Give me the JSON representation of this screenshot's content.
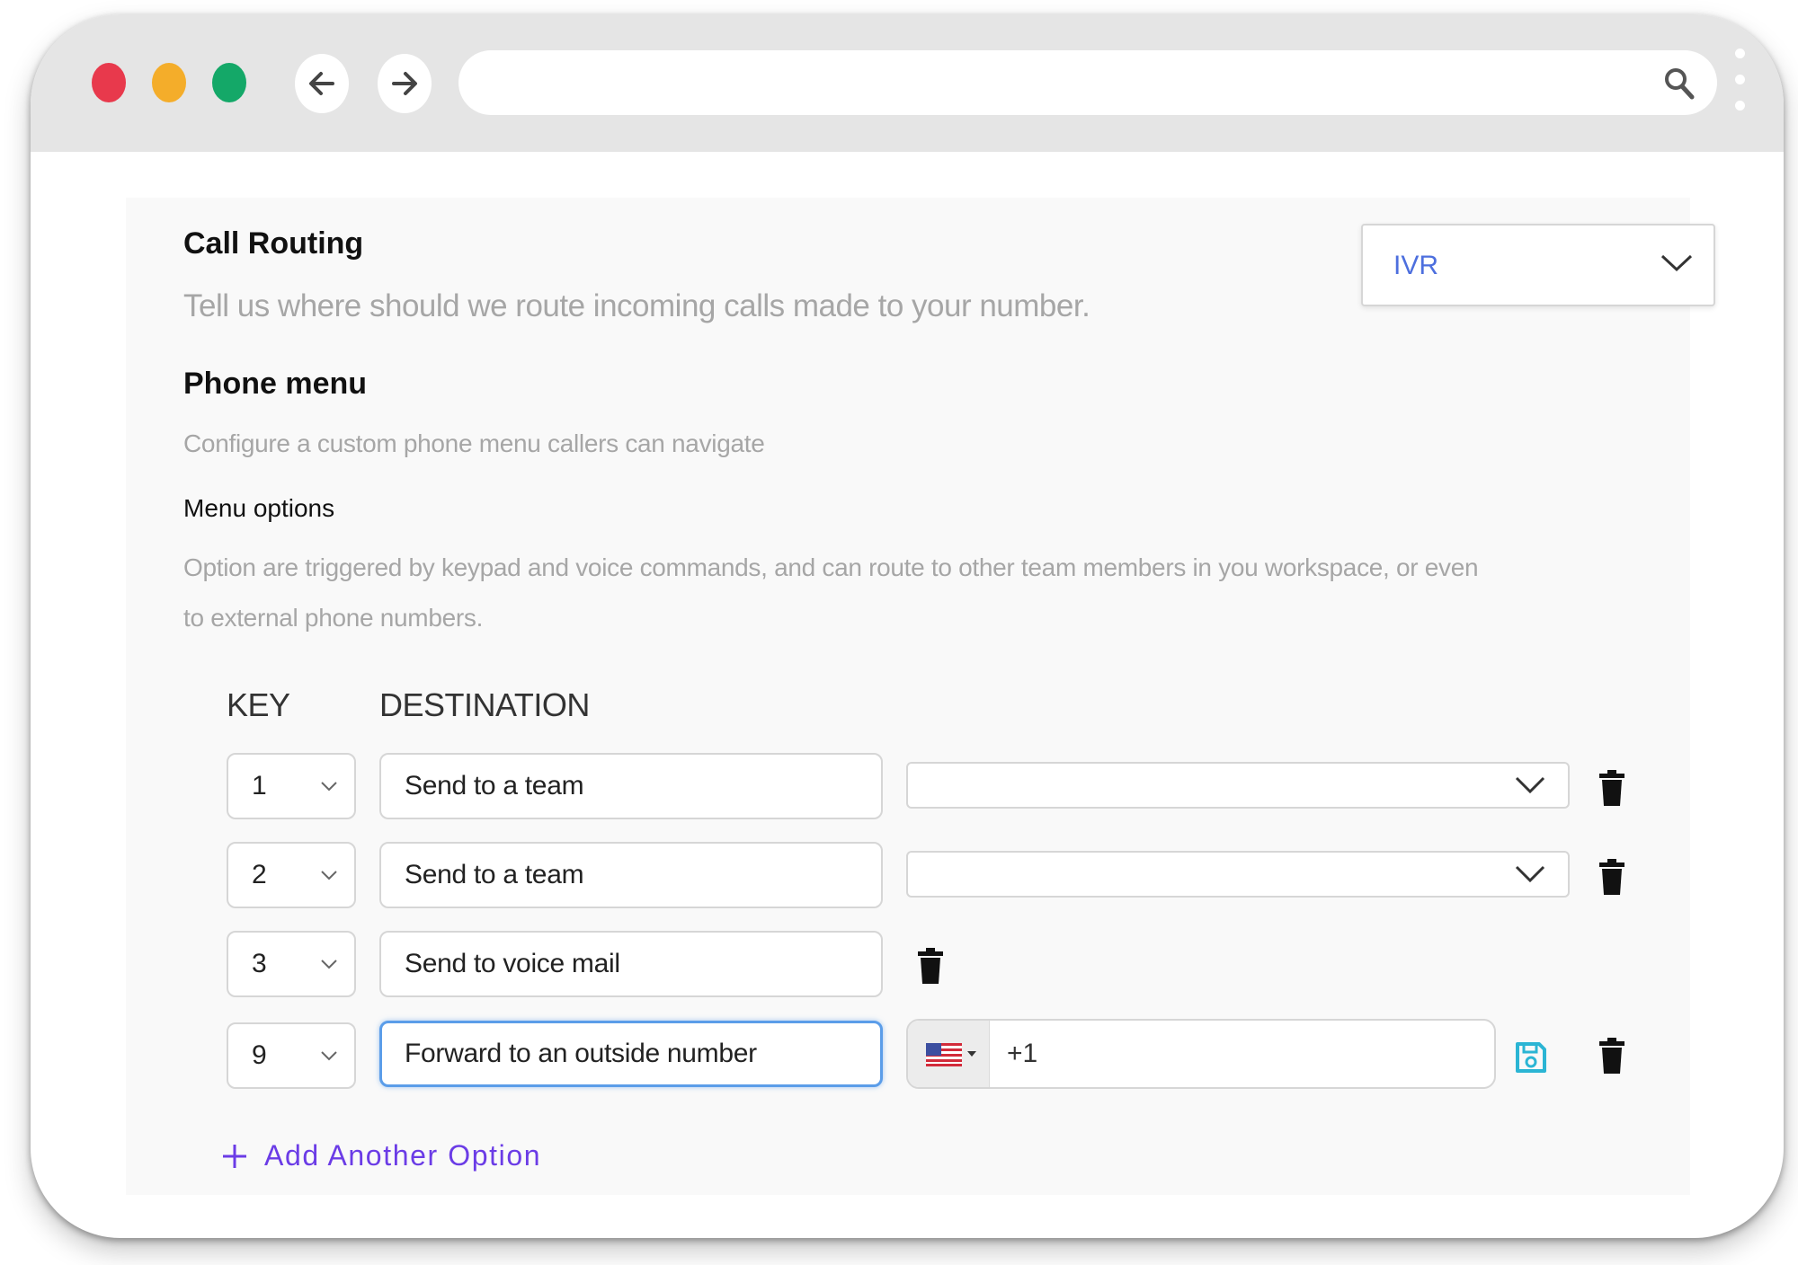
{
  "browser": {
    "traffic_lights": {
      "close": "#e8394c",
      "minimize": "#f4ad2a",
      "maximize": "#14a868"
    },
    "back_icon": "arrow-left-icon",
    "forward_icon": "arrow-right-icon",
    "address": {
      "value": "",
      "search_icon": "search-icon"
    },
    "menu_icon": "kebab-menu-icon"
  },
  "call_routing": {
    "title": "Call Routing",
    "description": "Tell us where should we route incoming calls made to your number.",
    "mode": "IVR"
  },
  "phone_menu": {
    "title": "Phone menu",
    "description": "Configure a custom phone menu callers can navigate"
  },
  "menu_options": {
    "title": "Menu options",
    "description_line1": "Option are triggered by keypad and voice commands, and can route to other team members in you workspace, or even",
    "description_line2": "to external phone numbers.",
    "column_key": "KEY",
    "column_destination": "DESTINATION",
    "rows": [
      {
        "key": "1",
        "destination": "Send to a team",
        "team": ""
      },
      {
        "key": "2",
        "destination": "Send to a team",
        "team": ""
      },
      {
        "key": "3",
        "destination": "Send to voice mail"
      },
      {
        "key": "9",
        "destination": "Forward to an outside number",
        "country": "US",
        "phone": "+1"
      }
    ],
    "add_label": "Add Another Option"
  },
  "colors": {
    "accent_purple": "#6b3ce6",
    "select_value_blue": "#4d6fde",
    "focus_blue": "#5b9de9",
    "save_icon": "#2bb5d4"
  }
}
